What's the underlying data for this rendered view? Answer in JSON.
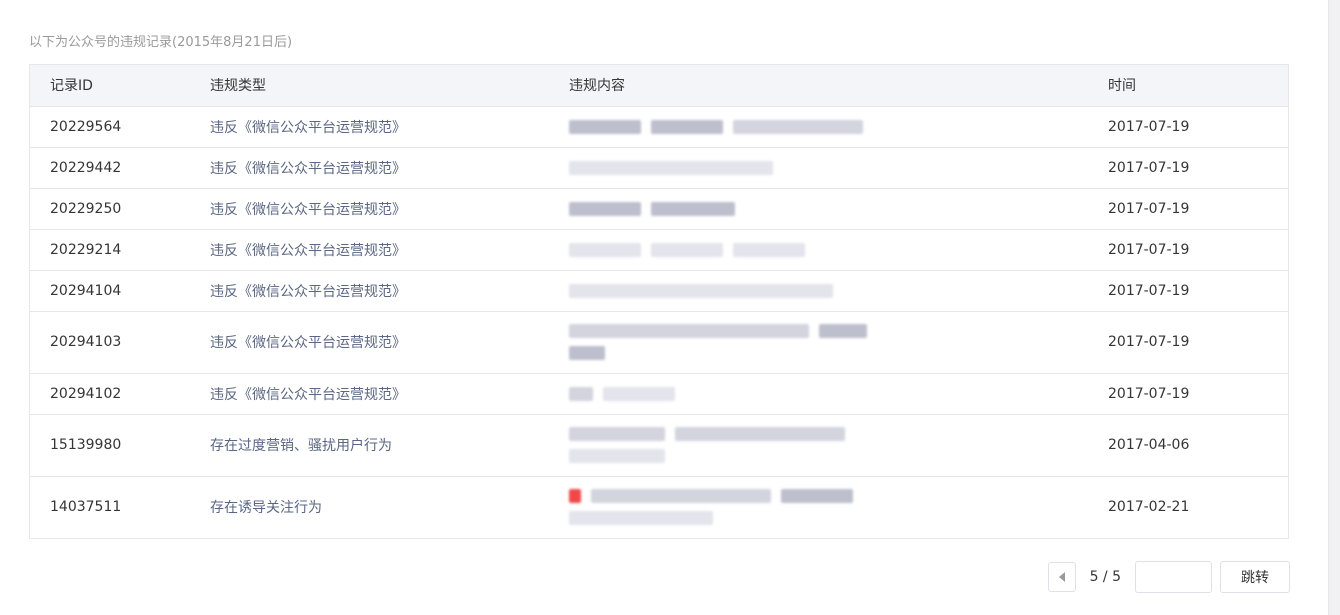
{
  "intro_text": "以下为公众号的违规记录(2015年8月21日后)",
  "table": {
    "headers": {
      "id": "记录ID",
      "type": "违规类型",
      "content": "违规内容",
      "time": "时间"
    },
    "rows": [
      {
        "id": "20229564",
        "type": "违反《微信公众平台运营规范》",
        "time": "2017-07-19"
      },
      {
        "id": "20229442",
        "type": "违反《微信公众平台运营规范》",
        "time": "2017-07-19"
      },
      {
        "id": "20229250",
        "type": "违反《微信公众平台运营规范》",
        "time": "2017-07-19"
      },
      {
        "id": "20229214",
        "type": "违反《微信公众平台运营规范》",
        "time": "2017-07-19"
      },
      {
        "id": "20294104",
        "type": "违反《微信公众平台运营规范》",
        "time": "2017-07-19"
      },
      {
        "id": "20294103",
        "type": "违反《微信公众平台运营规范》",
        "time": "2017-07-19"
      },
      {
        "id": "20294102",
        "type": "违反《微信公众平台运营规范》",
        "time": "2017-07-19"
      },
      {
        "id": "15139980",
        "type": "存在过度营销、骚扰用户行为",
        "time": "2017-04-06"
      },
      {
        "id": "14037511",
        "type": "存在诱导关注行为",
        "time": "2017-02-21"
      }
    ]
  },
  "pagination": {
    "info": "5 / 5",
    "input_value": "",
    "jump_label": "跳转"
  },
  "colors": {
    "link": "#5a6683",
    "header_bg": "#f4f5f9",
    "border": "#e7e7eb"
  }
}
